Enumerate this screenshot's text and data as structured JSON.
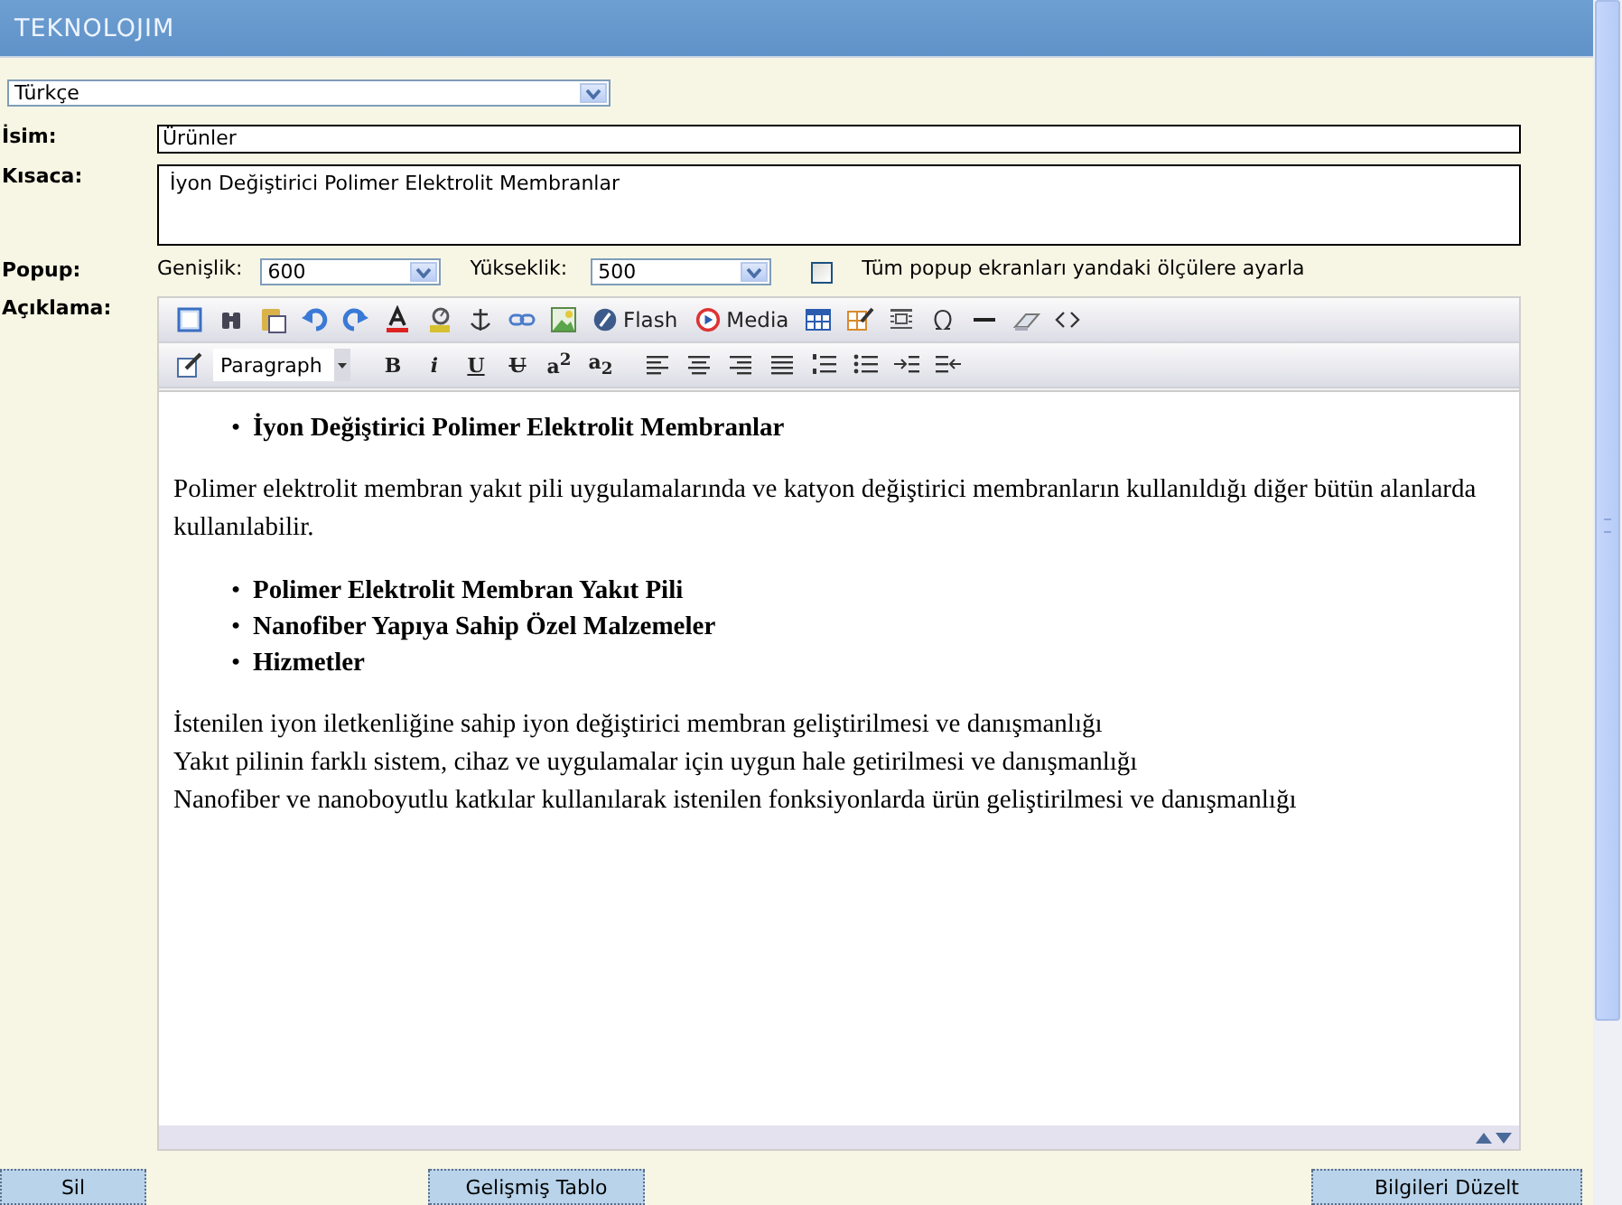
{
  "header": {
    "logo": "TEKNOLOJIM"
  },
  "language": {
    "value": "Türkçe"
  },
  "fields": {
    "name_label": "İsim:",
    "name_value": "Ürünler",
    "summary_label": "Kısaca:",
    "summary_value": "İyon Değiştirici Polimer Elektrolit Membranlar"
  },
  "popup": {
    "label": "Popup:",
    "width_label": "Genişlik:",
    "width_value": "600",
    "height_label": "Yükseklik:",
    "height_value": "500",
    "apply_all": {
      "label": "Tüm popup ekranları yandaki ölçülere ayarla",
      "checked": false
    }
  },
  "editor": {
    "label": "Açıklama:",
    "flash": "Flash",
    "media": "Media",
    "format": "Paragraph",
    "format_buttons": [
      {
        "kind": "bold",
        "label": "B"
      },
      {
        "kind": "italic",
        "label": "i"
      },
      {
        "kind": "underline",
        "label": "U"
      },
      {
        "kind": "strike",
        "label": "U"
      },
      {
        "kind": "sup",
        "label": "a$^{2}$"
      },
      {
        "kind": "sub",
        "label": "a$_{2}$"
      }
    ],
    "content": [
      {
        "kind": "bullets",
        "marker": "•",
        "items": [
          "İyon Değiştirici Polimer Elektrolit Membranlar"
        ]
      },
      {
        "kind": "paragraph",
        "text": "Polimer elektrolit membran yakıt pili uygulamalarında ve katyon değiştirici membranların kullanıldığı diğer bütün alanlarda kullanılabilir."
      },
      {
        "kind": "bullets",
        "marker": "•",
        "items": [
          "Polimer Elektrolit Membran Yakıt Pili",
          "Nanofiber Yapıya Sahip Özel Malzemeler",
          "Hizmetler"
        ]
      },
      {
        "kind": "lines",
        "lines": [
          "İstenilen iyon iletkenliğine sahip iyon değiştirici membran geliştirilmesi ve danışmanlığı",
          "Yakıt pilinin farklı sistem, cihaz ve uygulamalar için uygun hale getirilmesi ve danışmanlığı",
          "Nanofiber ve nanoboyutlu katkılar kullanılarak istenilen fonksiyonlarda ürün geliştirilmesi ve danışmanlığı"
        ]
      }
    ]
  },
  "buttons": [
    {
      "label": "Sil"
    },
    {
      "label": "Gelişmiş Tablo"
    },
    {
      "label": "Bilgileri Düzelt"
    }
  ]
}
